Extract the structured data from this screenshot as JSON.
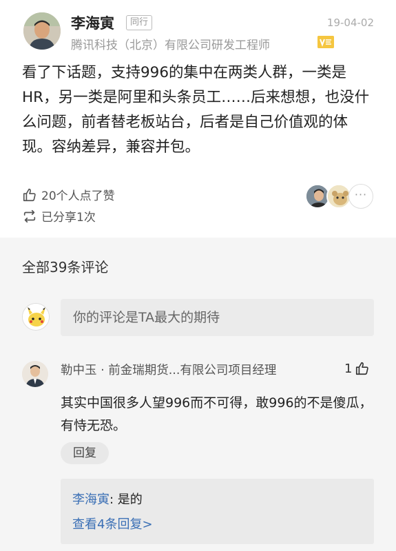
{
  "post": {
    "author": "李海寅",
    "peer_badge": "同行",
    "date": "19-04-02",
    "author_title": "腾讯科技（北京）有限公司研发工程师",
    "text": "看了下话题，支持996的集中在两类人群，一类是HR，另一类是阿里和头条员工……后来想想，也没什么问题，前者替老板站台，后者是自己价值观的体现。容纳差异，兼容并包。",
    "likes": "20个人点了赞",
    "shares": "已分享1次",
    "more_likers": "···"
  },
  "comments": {
    "count_label": "全部39条评论",
    "input_placeholder": "你的评论是TA最大的期待",
    "items": [
      {
        "author": "勒中玉 · 前金瑞期货...有限公司项目经理",
        "like_count": "1",
        "text": "其实中国很多人望996而不可得，敢996的不是傻瓜，有恃无恐。",
        "reply_label": "回复",
        "reply_author": "李海寅",
        "reply_text": ": 是的",
        "view_replies": "查看4条回复>"
      }
    ]
  },
  "colors": {
    "link": "#3a6fb5",
    "v_badge": "#f5c640",
    "section_bg": "#f5f5f5"
  }
}
